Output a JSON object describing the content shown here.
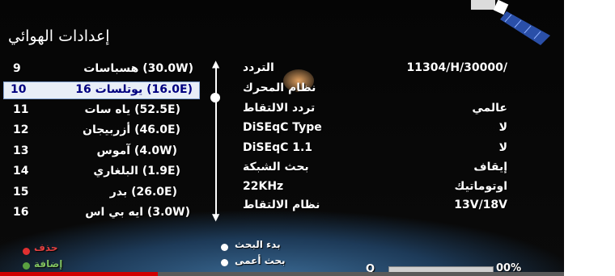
{
  "title": "إعدادات الهوائي",
  "satellites": [
    {
      "num": "9",
      "name": "هسباسات (30.0W)"
    },
    {
      "num": "10",
      "name": "16 يوتلسات (16.0E)",
      "selected": true
    },
    {
      "num": "11",
      "name": "ياه سات (52.5E)"
    },
    {
      "num": "12",
      "name": "أزربيجان (46.0E)"
    },
    {
      "num": "13",
      "name": "آموس (4.0W)"
    },
    {
      "num": "14",
      "name": "البلغاري (1.9E)"
    },
    {
      "num": "15",
      "name": "بدر (26.0E)"
    },
    {
      "num": "16",
      "name": "ايه بي اس (3.0W)"
    }
  ],
  "settings": [
    {
      "label": "التردد",
      "value": "11304/H/30000/"
    },
    {
      "label": "نظام المحرك",
      "value": ""
    },
    {
      "label": "تردد الالتقاط",
      "value": "عالمي"
    },
    {
      "label": "DiSEqC Type",
      "value": "لا"
    },
    {
      "label": "DiSEqC 1.1",
      "value": "لا"
    },
    {
      "label": "بحث الشبكة",
      "value": "إيقاف"
    },
    {
      "label": "22KHz",
      "value": "اوتوماتيك"
    },
    {
      "label": "نظام الالتقاط",
      "value": "13V/18V"
    }
  ],
  "hints": {
    "delete": "حذف",
    "add": "إضافة",
    "start_search": "بدء البحث",
    "blind_search": "بحث أعمى"
  },
  "quality": {
    "label": "Q",
    "value_text": "00%",
    "fraction": 0.0
  },
  "video_progress_fraction": 0.28,
  "colors": {
    "selected_row": "#e8eef7",
    "delete": "#e03030",
    "add": "#5aa040"
  }
}
